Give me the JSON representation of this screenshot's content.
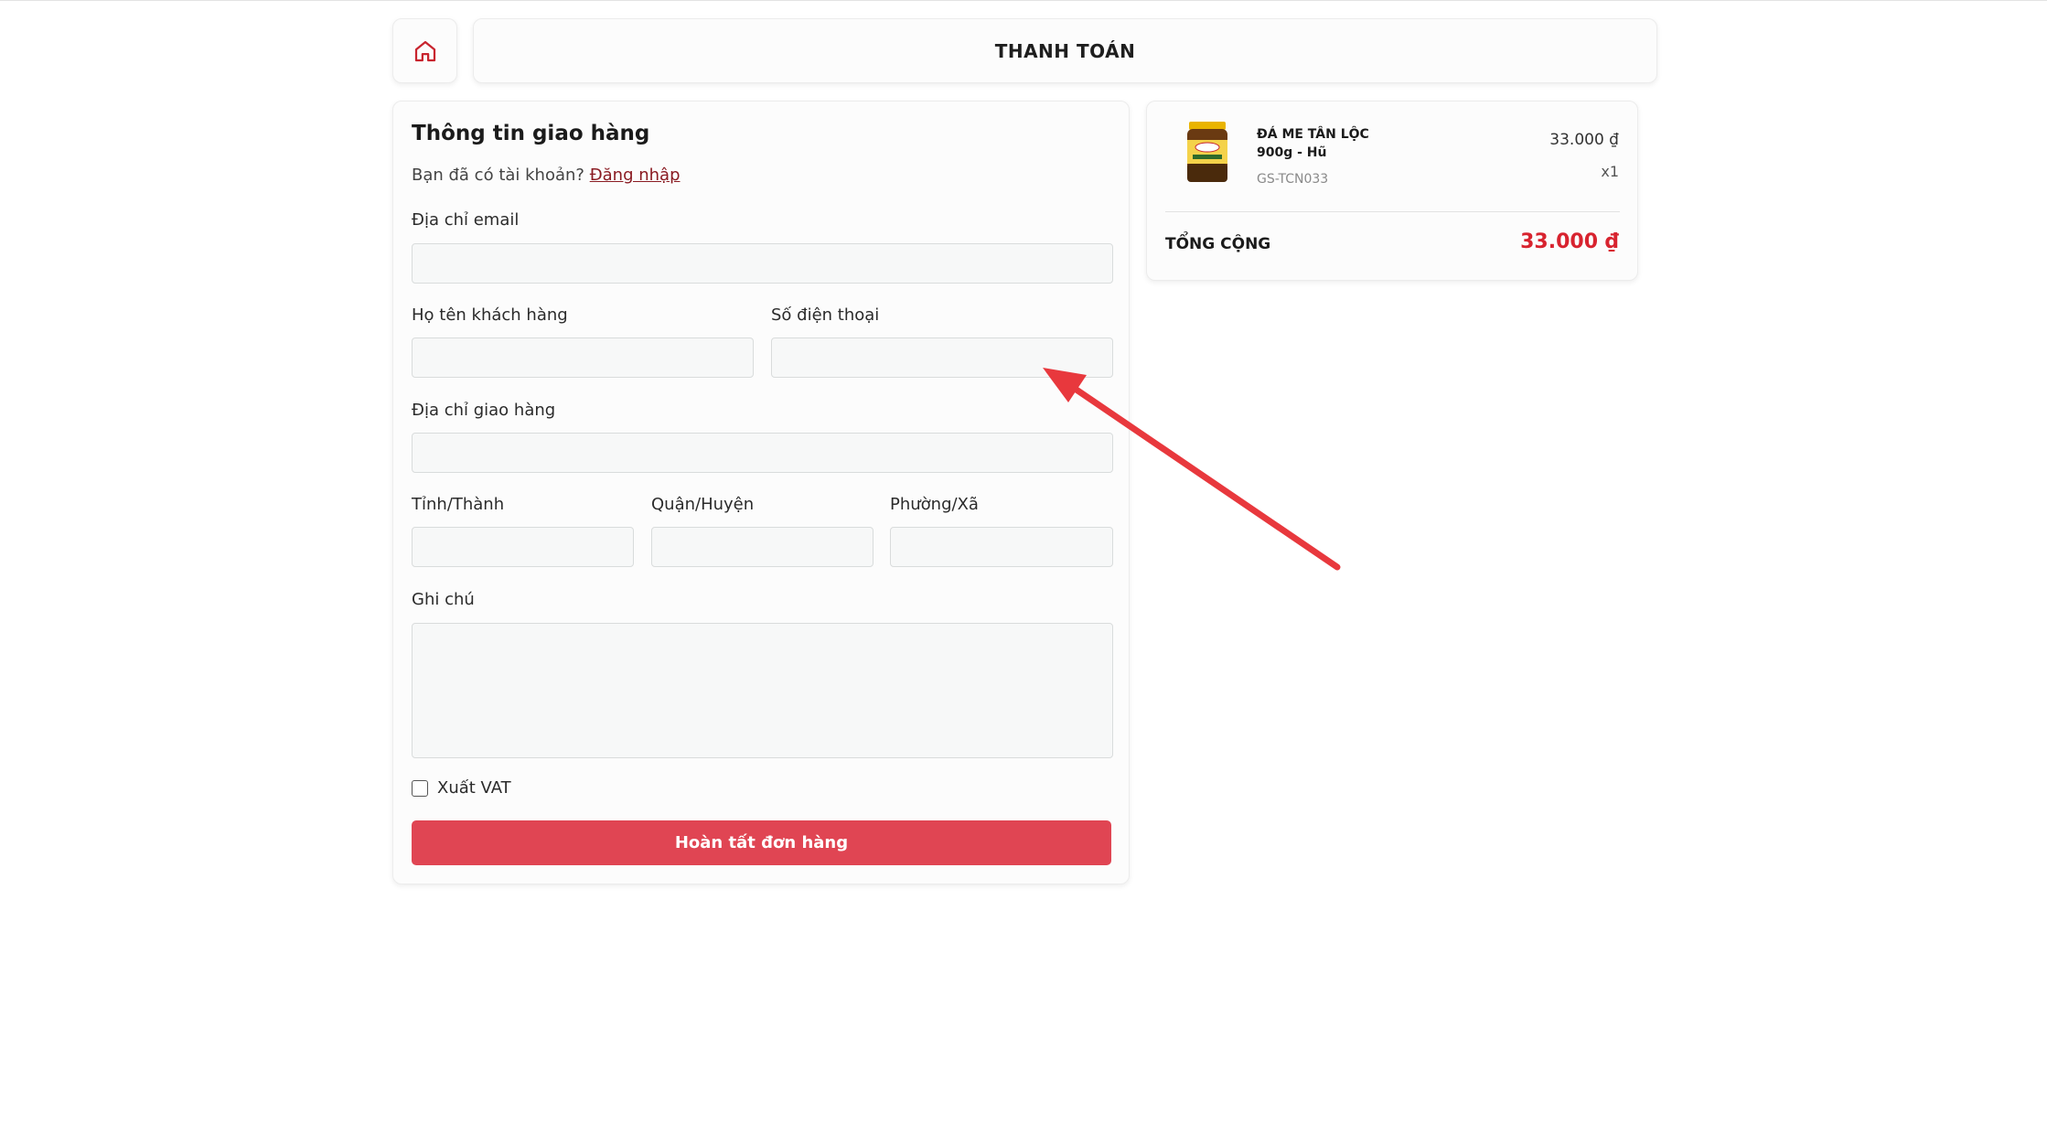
{
  "header": {
    "title": "THANH TOÁN",
    "home_icon": "home-icon"
  },
  "form": {
    "title": "Thông tin giao hàng",
    "account_prompt": "Bạn đã có tài khoản?",
    "login_link": "Đăng nhập",
    "email_label": "Địa chỉ email",
    "email_value": "",
    "name_label": "Họ tên khách hàng",
    "name_value": "",
    "phone_label": "Số điện thoại",
    "phone_value": "",
    "address_label": "Địa chỉ giao hàng",
    "address_value": "",
    "province_label": "Tỉnh/Thành",
    "province_value": "",
    "district_label": "Quận/Huyện",
    "district_value": "",
    "ward_label": "Phường/Xã",
    "ward_value": "",
    "note_label": "Ghi chú",
    "note_value": "",
    "vat_label": "Xuất VAT",
    "vat_checked": false,
    "submit_label": "Hoàn tất đơn hàng"
  },
  "order": {
    "product_name": "ĐÁ ME TÂN LỘC 900g - Hũ",
    "product_sku": "GS-TCN033",
    "product_price": "33.000 ₫",
    "product_qty": "x1",
    "total_label": "TỔNG CỘNG",
    "total_value": "33.000 ₫"
  },
  "colors": {
    "accent": "#e04553",
    "total": "#d8232f",
    "link": "#8a1b22",
    "annotation_arrow": "#e8383d"
  }
}
